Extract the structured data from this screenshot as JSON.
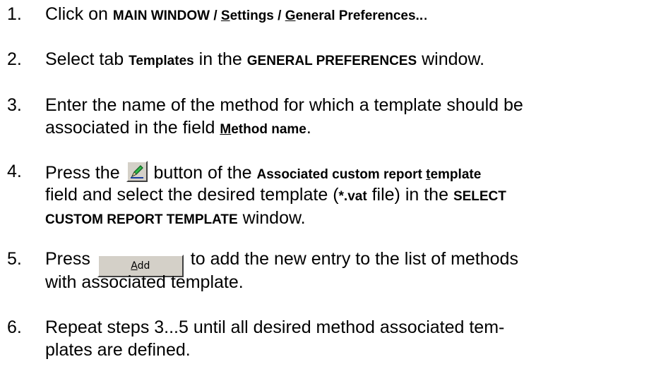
{
  "steps": [
    {
      "number": "1.",
      "lines": [
        {
          "t1": "Click on ",
          "b1": "MAIN WINDOW / ",
          "b1u": "S",
          "b2": "ettings / ",
          "b2u": "G",
          "b3": "eneral Preferences..",
          "t2": "."
        }
      ]
    },
    {
      "number": "2.",
      "lines": [
        {
          "t1": "Select tab ",
          "b1": "Templates",
          "t2": " in the ",
          "b2": "GENERAL PREFERENCES",
          "t3": " window."
        }
      ]
    },
    {
      "number": "3.",
      "lines": [
        {
          "t1": "Enter the name of the method for which a template should be"
        },
        {
          "t1": "associated in the field ",
          "bu": "M",
          "b1": "ethod name",
          "t2": "."
        }
      ]
    },
    {
      "number": "4.",
      "lines": [
        {
          "t1": "Press the ",
          "icon": "pencil-icon",
          "t2": " button of the ",
          "b1": "Associated custom report ",
          "bu": "t",
          "b2": "emplate"
        },
        {
          "t1": "field and select the desired template (",
          "b1": "*.vat",
          "t2": " file) in the ",
          "b2": "SELECT"
        },
        {
          "b1": "CUSTOM REPORT TEMPLATE",
          "t1": " window."
        }
      ]
    },
    {
      "number": "5.",
      "lines": [
        {
          "t1": "Press ",
          "button_u": "A",
          "button_rest": "dd",
          "t2": " to add the new entry to the list of methods"
        },
        {
          "t1": "with associated template."
        }
      ]
    },
    {
      "number": "6.",
      "lines": [
        {
          "t1": "Repeat steps 3...5 until all desired method associated tem-"
        },
        {
          "t1": "plates are defined."
        }
      ]
    }
  ]
}
